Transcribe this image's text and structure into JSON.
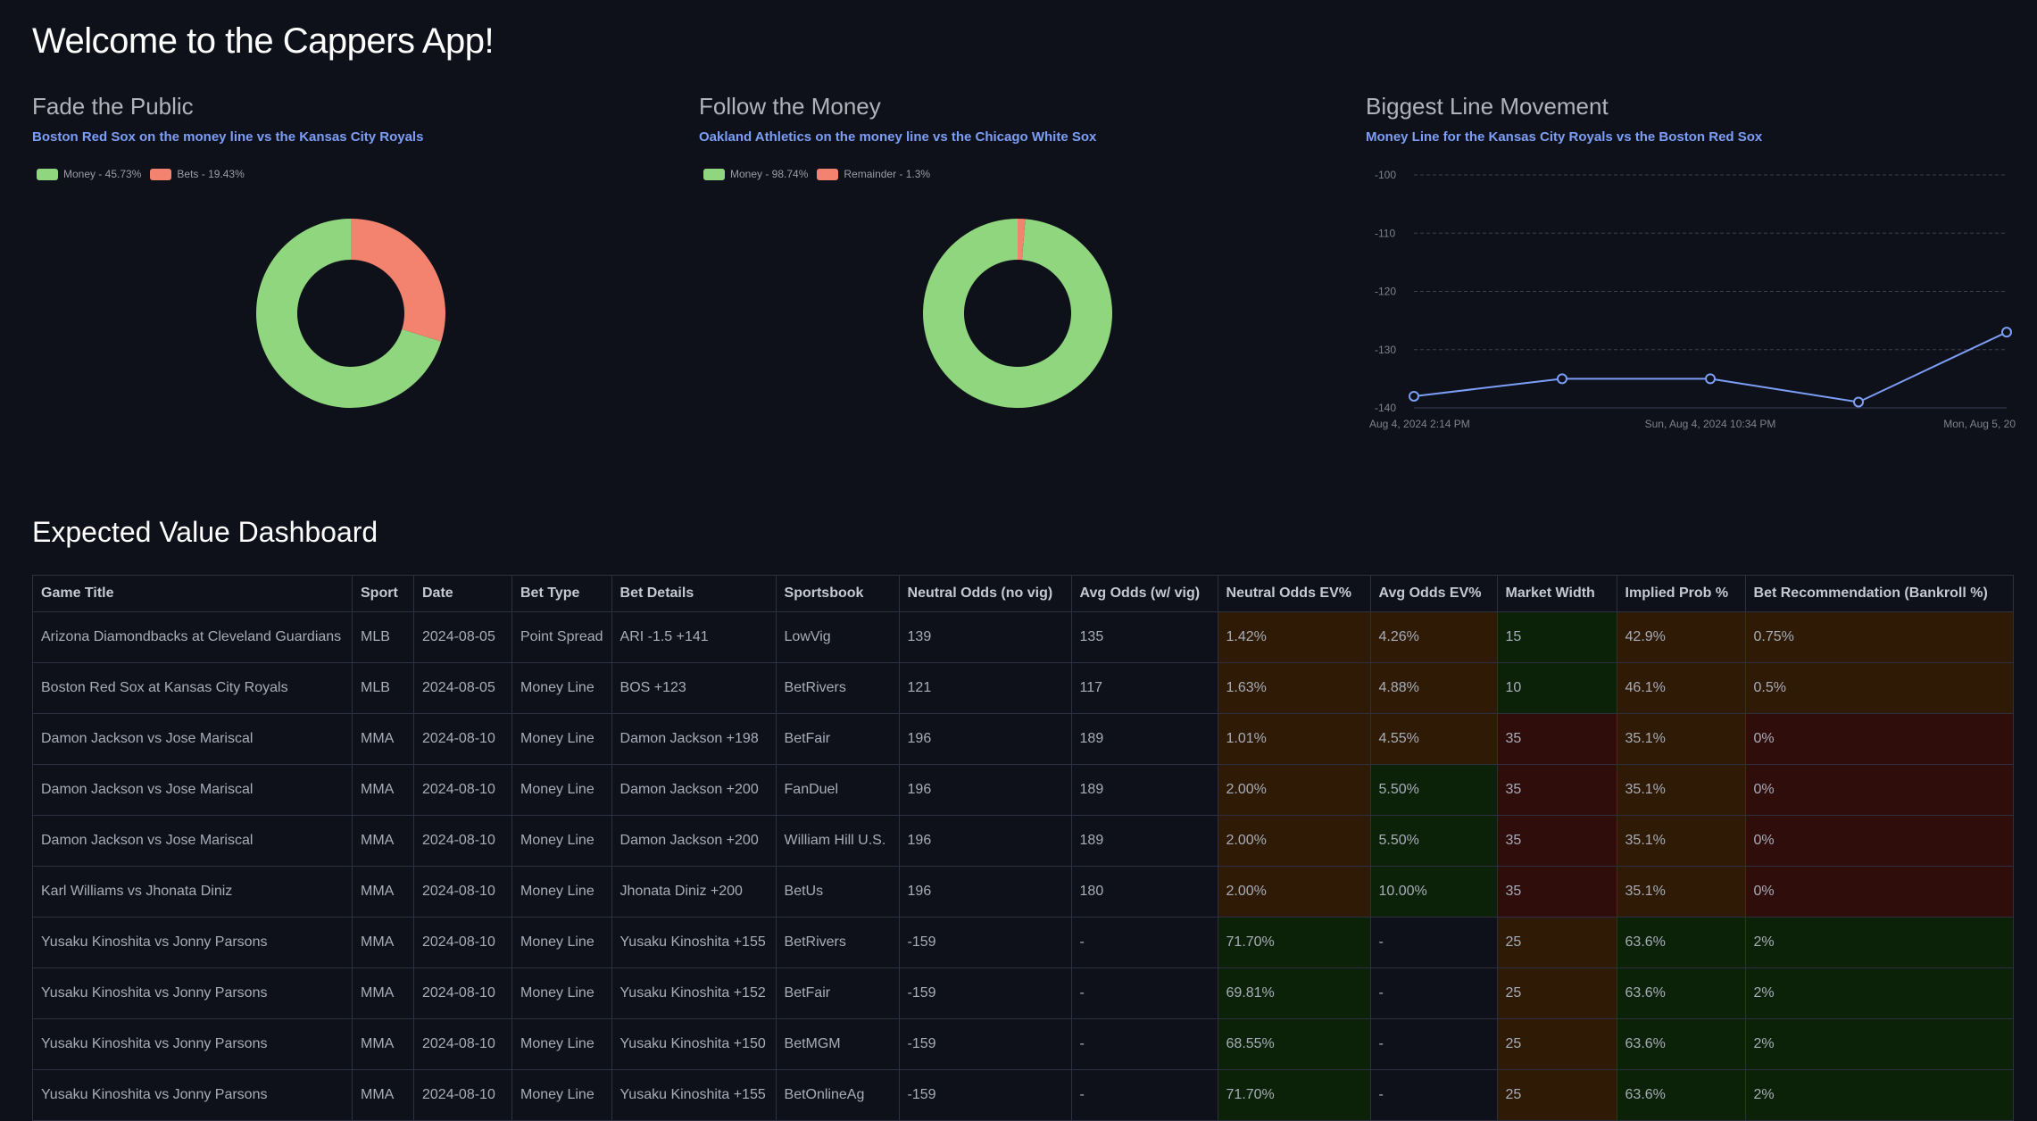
{
  "page_title": "Welcome to the Cappers App!",
  "colors": {
    "background": "#0f111a",
    "accent": "#7c9ef7",
    "money": "#90d67e",
    "bets": "#f3836f",
    "cell_orange": "#2e1a05",
    "cell_green": "#0b2208",
    "cell_red": "#2f0d0b"
  },
  "panels": {
    "fade": {
      "title": "Fade the Public",
      "subtitle": "Boston Red Sox on the money line vs the Kansas City Royals"
    },
    "follow": {
      "title": "Follow the Money",
      "subtitle": "Oakland Athletics on the money line vs the Chicago White Sox"
    },
    "movement": {
      "title": "Biggest Line Movement",
      "subtitle": "Money Line for the Kansas City Royals vs the Boston Red Sox"
    }
  },
  "chart_data": [
    {
      "type": "pie",
      "title": "Fade the Public",
      "legend_position": "top-left",
      "series": [
        {
          "name": "Money - 45.73%",
          "value": 45.73,
          "color": "#90d67e"
        },
        {
          "name": "Bets - 19.43%",
          "value": 19.43,
          "color": "#f3836f"
        }
      ]
    },
    {
      "type": "pie",
      "title": "Follow the Money",
      "legend_position": "top-left",
      "series": [
        {
          "name": "Money - 98.74%",
          "value": 98.74,
          "color": "#90d67e"
        },
        {
          "name": "Remainder - 1.3%",
          "value": 1.3,
          "color": "#f3836f"
        }
      ]
    },
    {
      "type": "line",
      "title": "Biggest Line Movement",
      "x": [
        "Aug 4, 2024 2:14 PM",
        "",
        "Sun, Aug 4, 2024 10:34 PM",
        "",
        "Mon, Aug 5, 20"
      ],
      "x_tick_labels": [
        "Aug 4, 2024 2:14 PM",
        "Sun, Aug 4, 2024 10:34 PM",
        "Mon, Aug 5, 20"
      ],
      "series": [
        {
          "name": "Money Line",
          "values": [
            -138,
            -135,
            -135,
            -139,
            -127
          ],
          "color": "#7c9ef7"
        }
      ],
      "y_ticks": [
        -100,
        -110,
        -120,
        -130,
        -140
      ],
      "ylim": [
        -140,
        -100
      ],
      "grid": true
    }
  ],
  "ev_dashboard": {
    "title": "Expected Value Dashboard",
    "columns": [
      "Game Title",
      "Sport",
      "Date",
      "Bet Type",
      "Bet Details",
      "Sportsbook",
      "Neutral Odds (no vig)",
      "Avg Odds (w/ vig)",
      "Neutral Odds EV%",
      "Avg Odds EV%",
      "Market Width",
      "Implied Prob %",
      "Bet Recommendation (Bankroll %)"
    ],
    "rows": [
      {
        "cells": [
          "Arizona Diamondbacks at Cleveland Guardians",
          "MLB",
          "2024-08-05",
          "Point Spread",
          "ARI -1.5 +141",
          "LowVig",
          "139",
          "135",
          "1.42%",
          "4.26%",
          "15",
          "42.9%",
          "0.75%"
        ],
        "link": true,
        "tones": [
          "orange",
          "orange",
          "green",
          "orange",
          "orange"
        ]
      },
      {
        "cells": [
          "Boston Red Sox at Kansas City Royals",
          "MLB",
          "2024-08-05",
          "Money Line",
          "BOS +123",
          "BetRivers",
          "121",
          "117",
          "1.63%",
          "4.88%",
          "10",
          "46.1%",
          "0.5%"
        ],
        "link": true,
        "tones": [
          "orange",
          "orange",
          "green",
          "orange",
          "orange"
        ]
      },
      {
        "cells": [
          "Damon Jackson vs Jose Mariscal",
          "MMA",
          "2024-08-10",
          "Money Line",
          "Damon Jackson +198",
          "BetFair",
          "196",
          "189",
          "1.01%",
          "4.55%",
          "35",
          "35.1%",
          "0%"
        ],
        "link": false,
        "tones": [
          "orange",
          "orange",
          "red",
          "orange",
          "red"
        ]
      },
      {
        "cells": [
          "Damon Jackson vs Jose Mariscal",
          "MMA",
          "2024-08-10",
          "Money Line",
          "Damon Jackson +200",
          "FanDuel",
          "196",
          "189",
          "2.00%",
          "5.50%",
          "35",
          "35.1%",
          "0%"
        ],
        "link": false,
        "tones": [
          "orange",
          "green",
          "red",
          "orange",
          "red"
        ]
      },
      {
        "cells": [
          "Damon Jackson vs Jose Mariscal",
          "MMA",
          "2024-08-10",
          "Money Line",
          "Damon Jackson +200",
          "William Hill U.S.",
          "196",
          "189",
          "2.00%",
          "5.50%",
          "35",
          "35.1%",
          "0%"
        ],
        "link": false,
        "tones": [
          "orange",
          "green",
          "red",
          "orange",
          "red"
        ]
      },
      {
        "cells": [
          "Karl Williams vs Jhonata Diniz",
          "MMA",
          "2024-08-10",
          "Money Line",
          "Jhonata Diniz +200",
          "BetUs",
          "196",
          "180",
          "2.00%",
          "10.00%",
          "35",
          "35.1%",
          "0%"
        ],
        "link": false,
        "tones": [
          "orange",
          "green",
          "red",
          "orange",
          "red"
        ]
      },
      {
        "cells": [
          "Yusaku Kinoshita vs Jonny Parsons",
          "MMA",
          "2024-08-10",
          "Money Line",
          "Yusaku Kinoshita +155",
          "BetRivers",
          "-159",
          "-",
          "71.70%",
          "-",
          "25",
          "63.6%",
          "2%"
        ],
        "link": false,
        "tones": [
          "green",
          "none",
          "orange",
          "green",
          "green"
        ]
      },
      {
        "cells": [
          "Yusaku Kinoshita vs Jonny Parsons",
          "MMA",
          "2024-08-10",
          "Money Line",
          "Yusaku Kinoshita +152",
          "BetFair",
          "-159",
          "-",
          "69.81%",
          "-",
          "25",
          "63.6%",
          "2%"
        ],
        "link": false,
        "tones": [
          "green",
          "none",
          "orange",
          "green",
          "green"
        ]
      },
      {
        "cells": [
          "Yusaku Kinoshita vs Jonny Parsons",
          "MMA",
          "2024-08-10",
          "Money Line",
          "Yusaku Kinoshita +150",
          "BetMGM",
          "-159",
          "-",
          "68.55%",
          "-",
          "25",
          "63.6%",
          "2%"
        ],
        "link": false,
        "tones": [
          "green",
          "none",
          "orange",
          "green",
          "green"
        ]
      },
      {
        "cells": [
          "Yusaku Kinoshita vs Jonny Parsons",
          "MMA",
          "2024-08-10",
          "Money Line",
          "Yusaku Kinoshita +155",
          "BetOnlineAg",
          "-159",
          "-",
          "71.70%",
          "-",
          "25",
          "63.6%",
          "2%"
        ],
        "link": false,
        "tones": [
          "green",
          "none",
          "orange",
          "green",
          "green"
        ]
      }
    ]
  }
}
